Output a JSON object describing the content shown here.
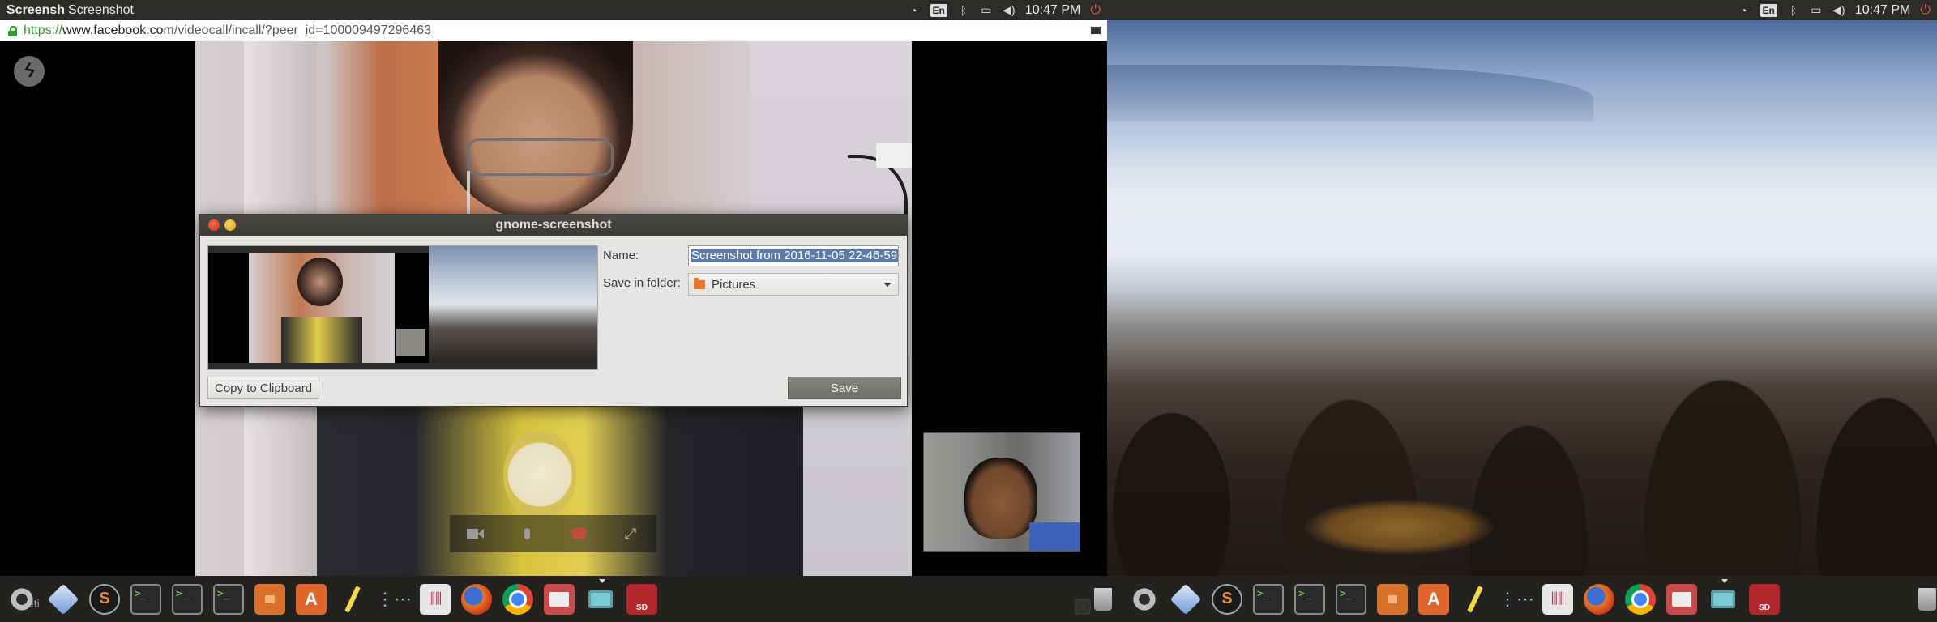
{
  "panel_left": {
    "app_name": "Screensh",
    "window_title": "Screenshot",
    "keyboard_layout": "En",
    "clock": "10:47 PM"
  },
  "panel_right": {
    "keyboard_layout": "En",
    "clock": "10:47 PM"
  },
  "browser": {
    "url_scheme": "https://",
    "url_host": "www.facebook.com",
    "url_path": "/videocall/incall/?peer_id=100009497296463"
  },
  "call": {
    "controls": [
      "video-camera-icon",
      "microphone-icon",
      "hang-up-icon",
      "fullscreen-icon"
    ],
    "accent_hangup": "#e04040"
  },
  "dialog": {
    "title": "gnome-screenshot",
    "name_label": "Name:",
    "name_value": "Screenshot from 2016-11-05 22-46-59",
    "folder_label": "Save in folder:",
    "folder_value": "Pictures",
    "copy_button": "Copy to Clipboard",
    "save_button": "Save"
  },
  "dock_left": {
    "ghost_text": "eti",
    "items": [
      "settings-icon",
      "cube-icon",
      "sublime-text-icon",
      "terminal-icon",
      "terminal-icon",
      "terminal-icon",
      "files-icon",
      "software-center-icon",
      "text-editor-icon",
      "network-icon",
      "mixer-icon",
      "firefox-icon",
      "chrome-icon",
      "printer-icon",
      "screenshot-icon",
      "sd-card-icon"
    ],
    "terminal_glyph": ">_",
    "sublime_glyph": "S",
    "store_glyph": "A",
    "sd_glyph": "SD"
  },
  "dock_right": {
    "items": [
      "trash-icon",
      "settings-icon",
      "cube-icon",
      "sublime-text-icon",
      "terminal-icon",
      "terminal-icon",
      "terminal-icon",
      "files-icon",
      "software-center-icon",
      "text-editor-icon",
      "network-icon",
      "mixer-icon",
      "firefox-icon",
      "chrome-icon",
      "printer-icon",
      "screenshot-icon",
      "sd-card-icon",
      "trash-icon"
    ]
  }
}
